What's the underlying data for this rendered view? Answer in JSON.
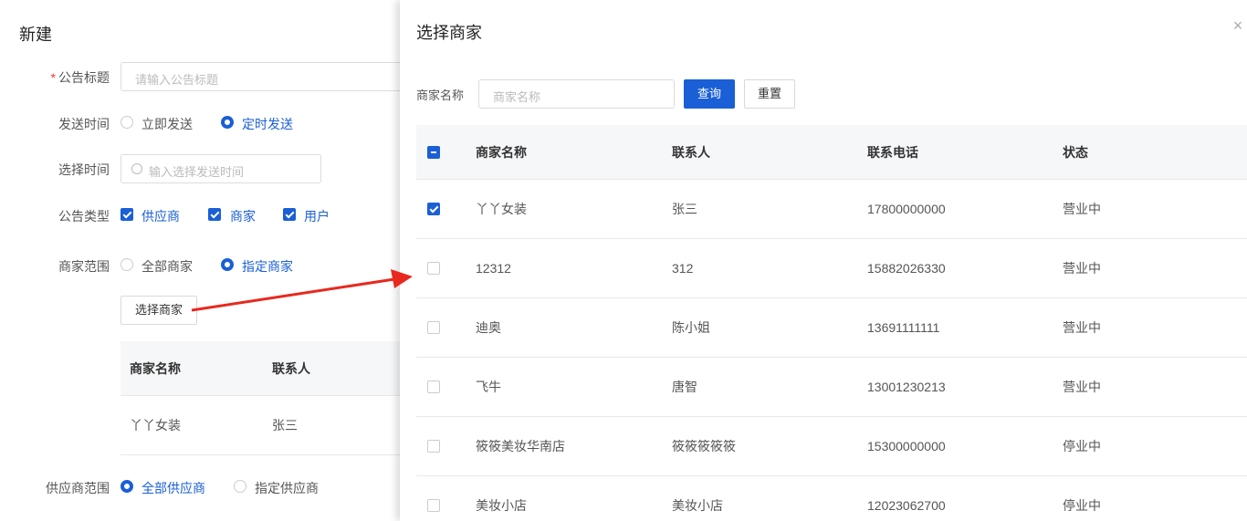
{
  "form": {
    "title": "新建",
    "notice_title_label": "公告标题",
    "notice_title_placeholder": "请输入公告标题",
    "send_time_label": "发送时间",
    "send_now": "立即发送",
    "send_scheduled": "定时发送",
    "pick_time_label": "选择时间",
    "pick_time_placeholder": "输入选择发送时间",
    "notice_type_label": "公告类型",
    "type_supplier": "供应商",
    "type_merchant": "商家",
    "type_user": "用户",
    "merchant_scope_label": "商家范围",
    "scope_all": "全部商家",
    "scope_specified": "指定商家",
    "select_merchant_button": "选择商家",
    "table_headers": [
      "商家名称",
      "联系人"
    ],
    "table_rows": [
      [
        "丫丫女装",
        "张三"
      ]
    ],
    "supplier_scope_label": "供应商范围",
    "supplier_all": "全部供应商",
    "supplier_specified": "指定供应商"
  },
  "drawer": {
    "title": "选择商家",
    "search_label": "商家名称",
    "search_placeholder": "商家名称",
    "query_button": "查询",
    "reset_button": "重置",
    "headers": [
      "商家名称",
      "联系人",
      "联系电话",
      "状态"
    ],
    "rows": [
      {
        "name": "丫丫女装",
        "contact": "张三",
        "phone": "17800000000",
        "status": "营业中",
        "checked": true
      },
      {
        "name": "12312",
        "contact": "312",
        "phone": "15882026330",
        "status": "营业中",
        "checked": false
      },
      {
        "name": "迪奥",
        "contact": "陈小姐",
        "phone": "13691111111",
        "status": "营业中",
        "checked": false
      },
      {
        "name": "飞牛",
        "contact": "唐智",
        "phone": "13001230213",
        "status": "营业中",
        "checked": false
      },
      {
        "name": "筱筱美妆华南店",
        "contact": "筱筱筱筱筱",
        "phone": "15300000000",
        "status": "停业中",
        "checked": false
      },
      {
        "name": "美妆小店",
        "contact": "美妆小店",
        "phone": "12023062700",
        "status": "停业中",
        "checked": false
      }
    ]
  },
  "colors": {
    "primary": "#1a5fd6",
    "arrow": "#e8281e",
    "required": "#e53935"
  }
}
